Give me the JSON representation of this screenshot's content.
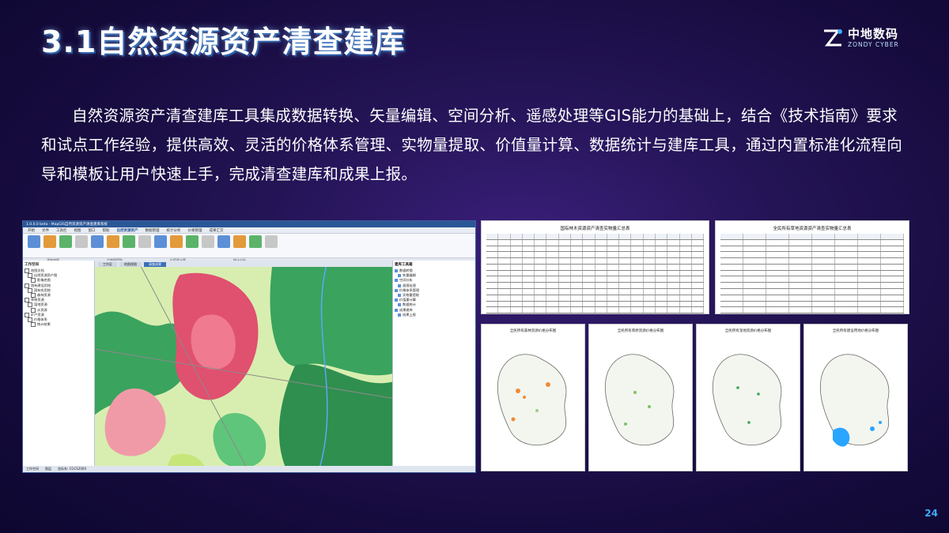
{
  "slide": {
    "title": "3.1自然资源资产清查建库",
    "paragraph": "自然资源资产清查建库工具集成数据转换、矢量编辑、空间分析、遥感处理等GIS能力的基础上，结合《技术指南》要求和试点工作经验，提供高效、灵活的价格体系管理、实物量提取、价值量计算、数据统计与建库工具，通过内置标准化流程向导和模板让用户快速上手，完成清查建库和成果上报。",
    "page_number": "24",
    "logo": {
      "cn": "中地数码",
      "en": "ZONDY CYBER",
      "icon": "zondy-logo-icon"
    }
  },
  "software": {
    "window_title": "1.0.0.0 beta - MapGIS自然资源资产清查建库系统",
    "ribbon_tabs": [
      "开始",
      "文件",
      "工具栏",
      "视图",
      "窗口",
      "帮助",
      "自然资源资产",
      "数据管理",
      "统计分析",
      "价格管理",
      "成果汇交"
    ],
    "active_tab": "自然资源资产",
    "ribbon_groups": [
      "清查底图",
      "实物量提取",
      "价值量计算",
      "统计分析"
    ],
    "left_panel_title": "工作空间",
    "tree_items": [
      "地图文档",
      "自然资源资产图",
      "影像底图",
      "国有建设用地",
      "国有农用地",
      "森林资源",
      "草原资源",
      "湿地资源",
      "水资源",
      "矿产资源",
      "价格体系",
      "统计结果"
    ],
    "map_tabs": [
      "工作区",
      "地图视图",
      "清查成果"
    ],
    "active_map_tab": "清查成果",
    "right_panel_title": "建库工具箱",
    "toolbox_items": [
      "数据转换",
      "矢量编辑",
      "空间分析",
      "遥感处理",
      "价格体系管理",
      "实物量提取",
      "价值量计算",
      "数据统计",
      "成果建库",
      "成果上报"
    ],
    "status_items": [
      "工作空间",
      "图层",
      "坐标系: CGCS2000"
    ]
  },
  "tables": {
    "table1_title": "国有林木资源资产清查实物量汇总表",
    "table2_title": "全民所有草地资源资产清查实物量汇总表"
  },
  "maps": {
    "map1_title": "全民所有森林资源价格分布图",
    "map2_title": "全民所有草原资源价格分布图",
    "map3_title": "全民所有湿地资源价格分布图",
    "map4_title": "全民所有建设用地价格分布图"
  }
}
